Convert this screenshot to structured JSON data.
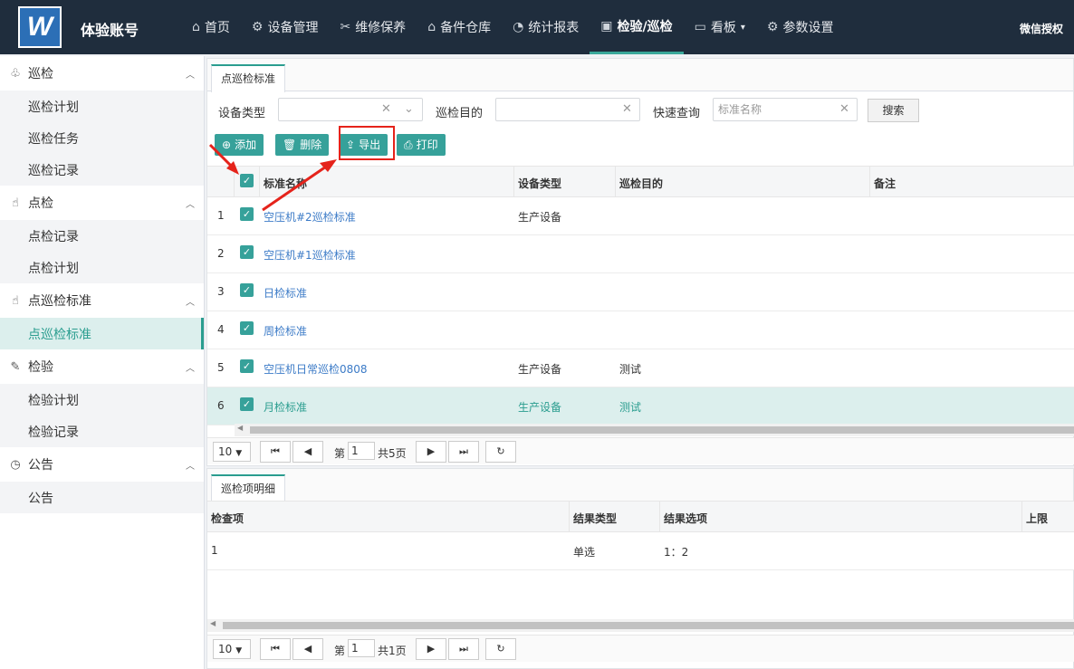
{
  "app": {
    "logo_letter": "W",
    "account_name": "体验账号",
    "wechat_auth": "微信授权"
  },
  "nav": [
    {
      "label": "首页",
      "icon": "⌂"
    },
    {
      "label": "设备管理",
      "icon": "⚙"
    },
    {
      "label": "维修保养",
      "icon": "✂"
    },
    {
      "label": "备件仓库",
      "icon": "⌂"
    },
    {
      "label": "统计报表",
      "icon": "◔"
    },
    {
      "label": "检验/巡检",
      "icon": "▣"
    },
    {
      "label": "看板",
      "icon": "▭"
    },
    {
      "label": "参数设置",
      "icon": "⚙"
    }
  ],
  "sidebar": {
    "groups": [
      {
        "label": "巡检",
        "icon": "♧",
        "items": [
          "巡检计划",
          "巡检任务",
          "巡检记录"
        ]
      },
      {
        "label": "点检",
        "icon": "☝",
        "items": [
          "点检记录",
          "点检计划"
        ]
      },
      {
        "label": "点巡检标准",
        "icon": "☝",
        "items": [
          "点巡检标准"
        ]
      },
      {
        "label": "检验",
        "icon": "✎",
        "items": [
          "检验计划",
          "检验记录"
        ]
      },
      {
        "label": "公告",
        "icon": "◷",
        "items": [
          "公告"
        ]
      }
    ],
    "active_item": "点巡检标准"
  },
  "main": {
    "tab": "点巡检标准",
    "filters": {
      "device_type_label": "设备类型",
      "purpose_label": "巡检目的",
      "quick_label": "快速查询",
      "quick_placeholder": "标准名称",
      "search_button": "搜索"
    },
    "toolbar": {
      "add": "添加",
      "delete": "删除",
      "export": "导出",
      "print": "打印"
    },
    "columns": [
      "标准名称",
      "设备类型",
      "巡检目的",
      "备注"
    ],
    "rows": [
      {
        "no": "1",
        "name": "空压机#2巡检标准",
        "device_type": "生产设备",
        "purpose": "",
        "remark": ""
      },
      {
        "no": "2",
        "name": "空压机#1巡检标准",
        "device_type": "",
        "purpose": "",
        "remark": ""
      },
      {
        "no": "3",
        "name": "日检标准",
        "device_type": "",
        "purpose": "",
        "remark": ""
      },
      {
        "no": "4",
        "name": "周检标准",
        "device_type": "",
        "purpose": "",
        "remark": ""
      },
      {
        "no": "5",
        "name": "空压机日常巡检0808",
        "device_type": "生产设备",
        "purpose": "测试",
        "remark": ""
      },
      {
        "no": "6",
        "name": "月检标准",
        "device_type": "生产设备",
        "purpose": "测试",
        "remark": ""
      }
    ],
    "selected_row": "6",
    "pager": {
      "page_size": "10",
      "page_prefix": "第",
      "current_page": "1",
      "total": "共5页"
    }
  },
  "detail": {
    "tab": "巡检项明细",
    "columns": [
      "检查项",
      "结果类型",
      "结果选项",
      "上限"
    ],
    "rows": [
      {
        "item": "1",
        "result_type": "单选",
        "options": "1：2",
        "upper": ""
      }
    ],
    "pager": {
      "page_size": "10",
      "page_prefix": "第",
      "current_page": "1",
      "total": "共1页"
    }
  },
  "colors": {
    "accent": "#36a19a",
    "topbar": "#1f2d3d",
    "highlight": "#e5231b",
    "link": "#3c7bc7"
  }
}
